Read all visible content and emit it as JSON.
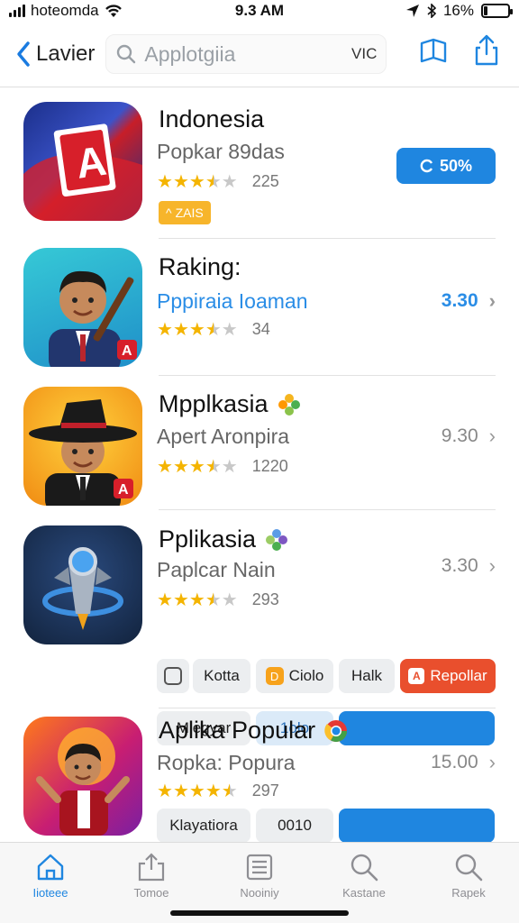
{
  "status_bar": {
    "carrier": "hoteomda",
    "time": "9.3 AM",
    "battery": "16%",
    "battery_level": 0.16
  },
  "nav": {
    "back_label": "Lavier",
    "search_placeholder": "Applotgiia",
    "search_tag": "VIC"
  },
  "apps": [
    {
      "title": "Indonesia",
      "subtitle": "Popkar 89das",
      "rating": 3.5,
      "rating_count": "225",
      "badge": "ZAIS",
      "action": "50%"
    },
    {
      "title": "Raking:",
      "subtitle": "Pppiraia Ioaman",
      "rating": 3.5,
      "rating_count": "34",
      "price": "3.30"
    },
    {
      "title": "Mpplkasia",
      "subtitle": "Apert Aronpira",
      "rating": 3.5,
      "rating_count": "1220",
      "price": "9.30"
    },
    {
      "title": "Pplikasia",
      "subtitle": "Paplcar Nain",
      "rating": 3.5,
      "rating_count": "293",
      "price": "3.30",
      "chips_row1": [
        "Mlegyar",
        "1olo"
      ],
      "chips_row2": [
        "Kotta",
        "Ciolo",
        "Halk",
        "Repollar"
      ]
    },
    {
      "title": "Aplika Popular",
      "subtitle": "Ropka: Popura",
      "rating": 4.5,
      "rating_count": "297",
      "price": "15.00",
      "chips_row1": [
        "Klayatiora",
        "0010"
      ]
    }
  ],
  "tabs": [
    {
      "label": "Iioteee",
      "icon": "home-icon",
      "active": true
    },
    {
      "label": "Tomoe",
      "icon": "share-icon",
      "active": false
    },
    {
      "label": "Nooiniy",
      "icon": "list-icon",
      "active": false
    },
    {
      "label": "Kastane",
      "icon": "search-icon",
      "active": false
    },
    {
      "label": "Rapek",
      "icon": "search-icon",
      "active": false
    }
  ],
  "colors": {
    "accent": "#1f86e0",
    "star": "#f4b400",
    "orange": "#e94f2d"
  }
}
